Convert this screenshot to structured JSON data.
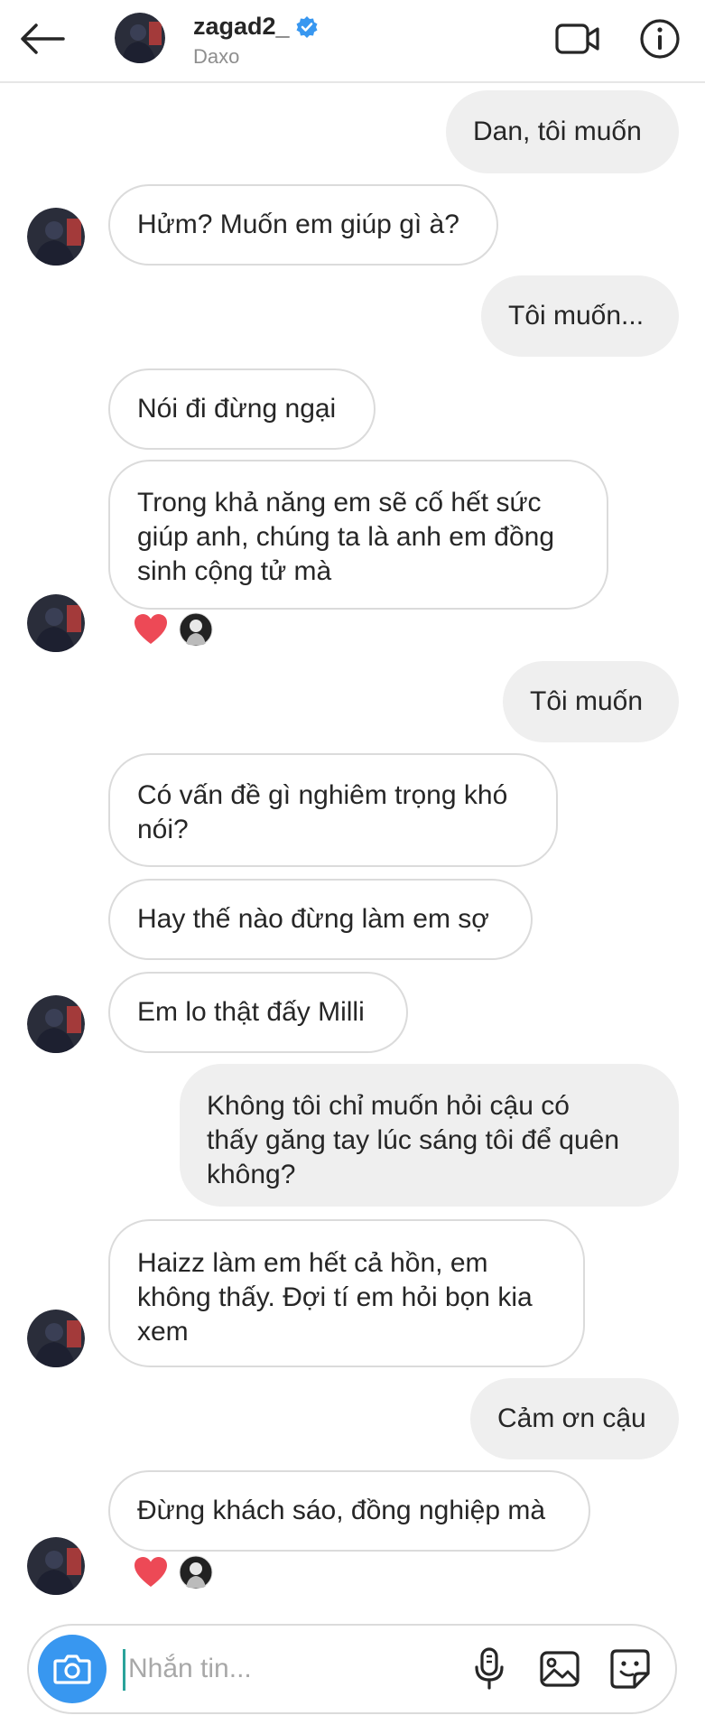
{
  "header": {
    "username": "zagad2_",
    "subtitle": "Daxo",
    "icons": {
      "back": "arrow-left-icon",
      "verified": "verified-badge-icon",
      "video": "video-call-icon",
      "info": "info-icon"
    }
  },
  "messages": [
    {
      "from": "me",
      "text": "Dan, tôi muốn"
    },
    {
      "from": "them",
      "text": "Hửm? Muốn em giúp gì à?"
    },
    {
      "from": "me",
      "text": "Tôi muốn..."
    },
    {
      "from": "them",
      "text": "Nói đi đừng ngại"
    },
    {
      "from": "them",
      "text": "Trong khả năng em sẽ cố hết sức\ngiúp anh, chúng ta là anh em đồng\nsinh cộng tử mà",
      "reactions": [
        "heart",
        "avatar"
      ]
    },
    {
      "from": "me",
      "text": "Tôi muốn"
    },
    {
      "from": "them",
      "text": "Có vấn đề gì nghiêm trọng khó\nnói?"
    },
    {
      "from": "them",
      "text": "Hay thế nào đừng làm em sợ"
    },
    {
      "from": "them",
      "text": "Em lo thật đấy Milli"
    },
    {
      "from": "me",
      "text": "Không tôi chỉ muốn hỏi cậu có\nthấy găng tay lúc sáng tôi để quên\nkhông?"
    },
    {
      "from": "them",
      "text": "Haizz làm em hết cả hồn, em\nkhông thấy. Đợi tí em hỏi bọn kia\nxem"
    },
    {
      "from": "me",
      "text": "Cảm ơn cậu"
    },
    {
      "from": "them",
      "text": "Đừng khách sáo, đồng nghiệp mà",
      "reactions": [
        "heart",
        "avatar"
      ]
    }
  ],
  "composer": {
    "placeholder": "Nhắn tin...",
    "icons": {
      "camera": "camera-icon",
      "mic": "microphone-icon",
      "gallery": "gallery-icon",
      "sticker": "sticker-icon"
    }
  },
  "colors": {
    "accent": "#3897f0",
    "heart": "#ed4956",
    "verified": "#3897f0",
    "out_bubble": "#efefef",
    "in_border": "#dbdbdb"
  }
}
